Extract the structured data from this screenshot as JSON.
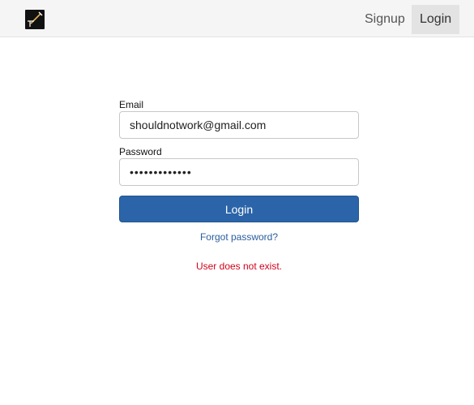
{
  "navbar": {
    "logo_icon": "pen-signature-icon",
    "signup_label": "Signup",
    "login_label": "Login"
  },
  "form": {
    "email_label": "Email",
    "email_value": "shouldnotwork@gmail.com",
    "password_label": "Password",
    "password_value": "•••••••••••••",
    "submit_label": "Login",
    "forgot_label": "Forgot password?",
    "error_message": "User does not exist."
  },
  "colors": {
    "primary": "#2b64a8",
    "error": "#d0021b",
    "navbar_bg": "#f5f5f5",
    "active_nav_bg": "#e3e3e3"
  }
}
